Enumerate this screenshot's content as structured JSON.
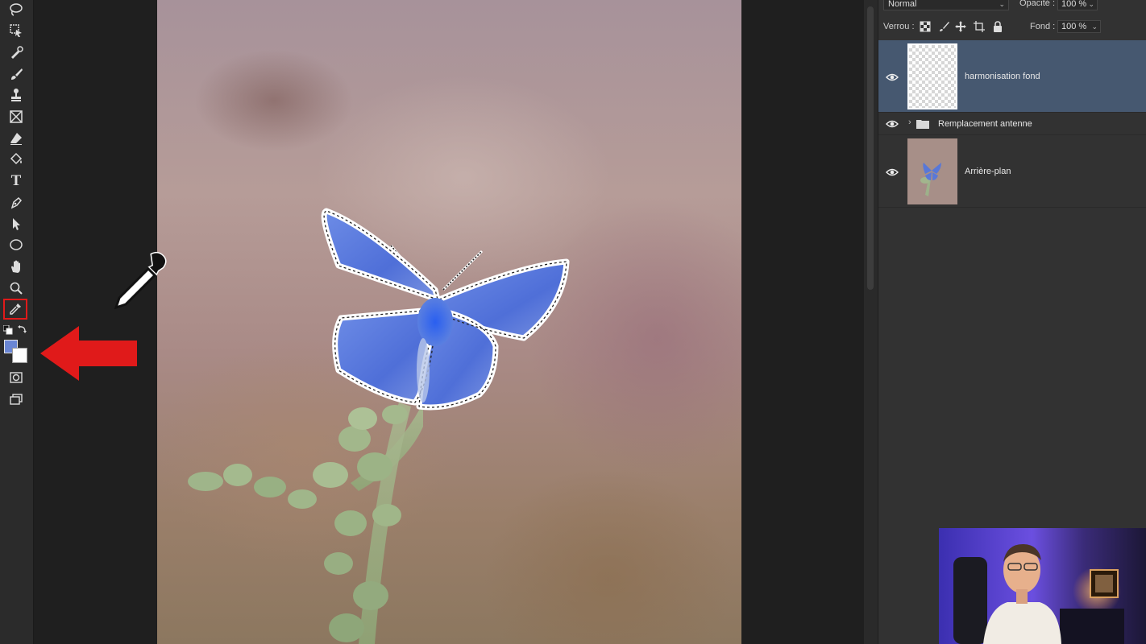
{
  "toolbar": {
    "tools": [
      {
        "icon": "lasso-icon"
      },
      {
        "icon": "object-selection-icon"
      },
      {
        "icon": "spot-healing-icon"
      },
      {
        "icon": "brush-icon"
      },
      {
        "icon": "clone-stamp-icon"
      },
      {
        "icon": "frame-icon"
      },
      {
        "icon": "eraser-icon"
      },
      {
        "icon": "paint-bucket-icon"
      },
      {
        "icon": "type-icon",
        "glyph": "T"
      },
      {
        "icon": "pen-icon"
      },
      {
        "icon": "path-selection-icon"
      },
      {
        "icon": "ellipse-icon"
      },
      {
        "icon": "hand-icon"
      },
      {
        "icon": "zoom-icon"
      },
      {
        "icon": "eyedropper-icon",
        "active": true
      }
    ],
    "foreground_color": "#6a86d4",
    "background_color": "#ffffff"
  },
  "layers_panel": {
    "blend_mode": "Normal",
    "opacity_label": "Opacité :",
    "opacity_value": "100 %",
    "lock_label": "Verrou :",
    "fill_label": "Fond :",
    "fill_value": "100 %",
    "layers": [
      {
        "name": "harmonisation fond",
        "visible": true,
        "selected": true,
        "type": "pixel-empty"
      },
      {
        "name": "Remplacement antenne",
        "visible": true,
        "selected": false,
        "type": "group",
        "collapsed": true
      },
      {
        "name": "Arrière-plan",
        "visible": true,
        "selected": false,
        "type": "background"
      }
    ]
  },
  "colors": {
    "selection_highlight": "#465870",
    "active_tool_border": "#e01a1a",
    "annotation_arrow": "#e01a1a"
  }
}
